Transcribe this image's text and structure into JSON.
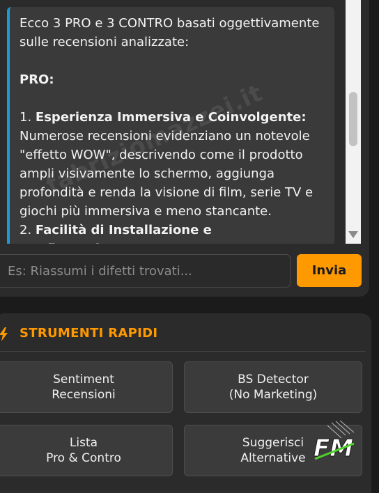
{
  "chat": {
    "intro": "Ecco 3 PRO e 3 CONTRO basati oggettivamente sulle recensioni analizzate:",
    "pro_heading": "PRO:",
    "point1_number": "1.",
    "point1_title": "Esperienza Immersiva e Coinvolgente:",
    "point1_text": "Numerose recensioni evidenziano un notevole \"effetto WOW\", descrivendo come il prodotto ampli visivamente lo schermo, aggiunga profondità e renda la visione di film, serie TV e giochi più immersiva e meno stancante.",
    "point2_number": "2.",
    "point2_title": "Facilità di Installazione e Configurazione:"
  },
  "input": {
    "placeholder": "Es: Riassumi i difetti trovati...",
    "send_label": "Invia"
  },
  "tools": {
    "title": "STRUMENTI RAPIDI",
    "buttons": [
      {
        "line1": "Sentiment",
        "line2": "Recensioni"
      },
      {
        "line1": "BS Detector",
        "line2": "(No Marketing)"
      },
      {
        "line1": "Lista",
        "line2": "Pro & Contro"
      },
      {
        "line1": "Suggerisci",
        "line2": "Alternative"
      }
    ]
  },
  "watermark": "fabriziomazzei.it",
  "logo_text": "FM",
  "colors": {
    "accent": "#ff9900",
    "message_border": "#1c9ad6",
    "panel_bg": "#2b2b2b",
    "page_bg": "#1b1b1b"
  }
}
